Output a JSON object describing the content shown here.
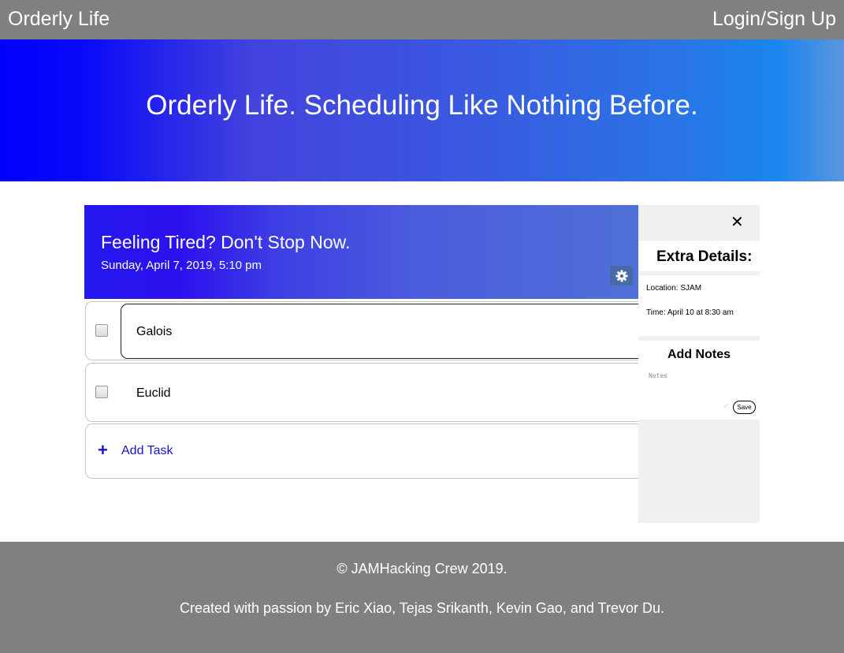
{
  "nav": {
    "brand": "Orderly Life",
    "login": "Login/Sign Up"
  },
  "hero": {
    "title": "Orderly Life. Scheduling Like Nothing Before."
  },
  "panel": {
    "title": "Feeling Tired? Don't Stop Now.",
    "date": "Sunday, April 7, 2019, 5:10 pm",
    "settings_icon": "gear-icon"
  },
  "tasks": [
    {
      "label": "Galois",
      "checked": false
    },
    {
      "label": "Euclid",
      "checked": false
    }
  ],
  "add_task": {
    "icon": "plus-icon",
    "label": "Add Task"
  },
  "details": {
    "close_icon": "close-icon",
    "heading": "Extra Details:",
    "location": "Location: SJAM",
    "time": "Time: April 10 at 8:30 am",
    "notes_heading": "Add Notes",
    "notes_placeholder": "Notes",
    "save_label": "Save"
  },
  "footer": {
    "copyright": "© JAMHacking Crew 2019.",
    "credits": "Created with passion by Eric Xiao, Tejas Srikanth, Kevin Gao, and Trevor Du."
  },
  "colors": {
    "bar_gray": "#808080",
    "accent_blue": "#1a10d8",
    "side_panel": "#f0f0f0"
  }
}
